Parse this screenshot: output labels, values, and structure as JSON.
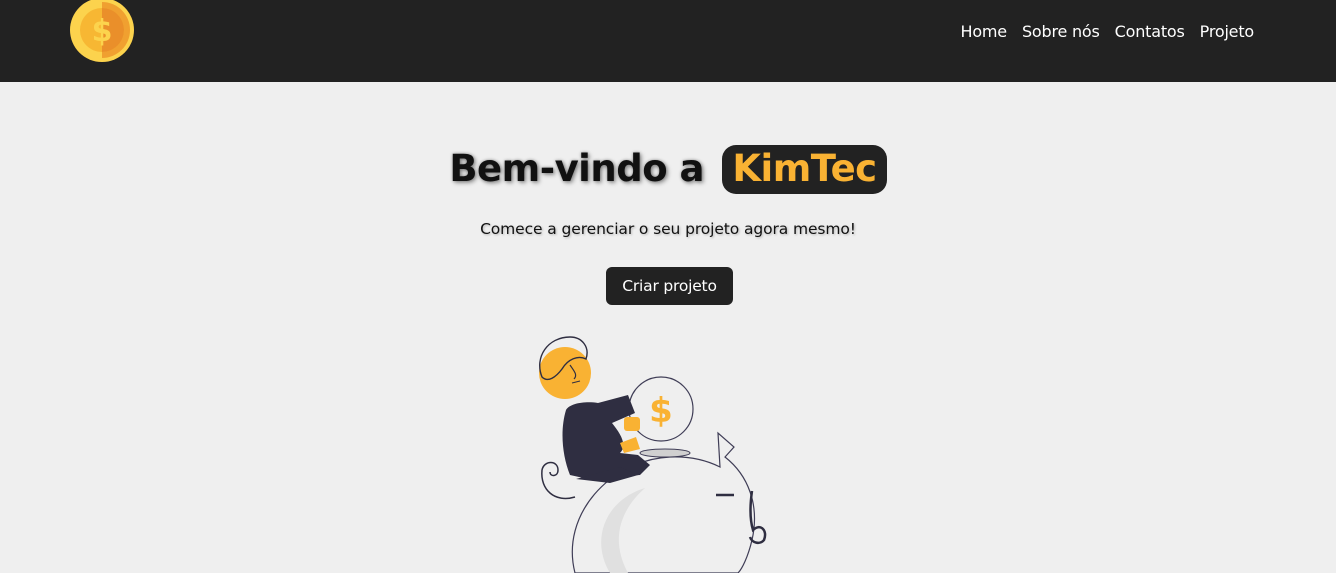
{
  "nav": {
    "logo_icon": "dollar-coin-icon",
    "links": [
      {
        "label": "Home"
      },
      {
        "label": "Sobre nós"
      },
      {
        "label": "Contatos"
      },
      {
        "label": "Projeto"
      }
    ]
  },
  "hero": {
    "title_prefix": "Bem-vindo a",
    "brand": "KimTec",
    "subtitle": "Comece a gerenciar o seu projeto agora mesmo!",
    "cta_label": "Criar projeto",
    "illustration": "person-saving-coin-in-piggy-bank"
  },
  "colors": {
    "navbar": "#222222",
    "background": "#efefef",
    "accent": "#f9b233",
    "dark": "#2f2e41"
  }
}
